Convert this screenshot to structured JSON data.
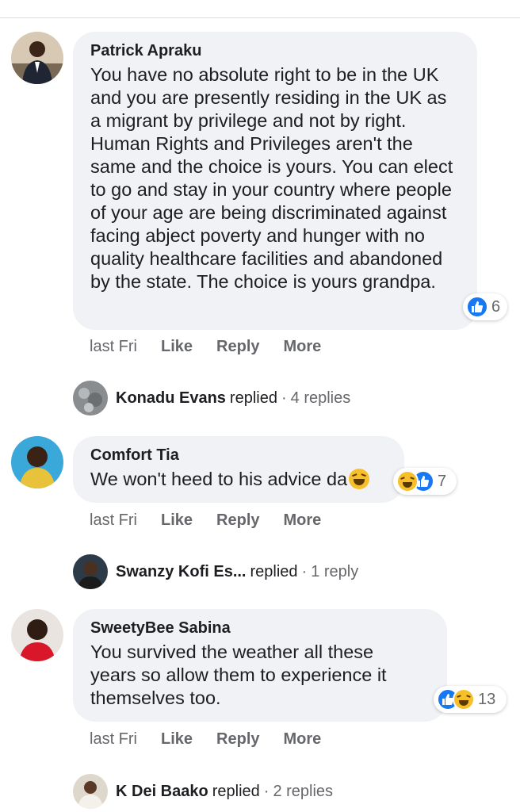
{
  "comments": [
    {
      "author": "Patrick Apraku",
      "text": "You have no absolute right to be in the UK and you are presently residing in the UK as a migrant by privilege and not by right. Human Rights and Privileges aren't the same and the choice is yours. You can elect to go and stay in your country where people of your age are being discriminated against facing abject poverty and hunger with no quality healthcare facilities and abandoned by the state. The choice is yours grandpa.",
      "reaction_count": "6",
      "time": "last Fri",
      "like": "Like",
      "reply": "Reply",
      "more": "More",
      "reply_summary": {
        "name": "Konadu Evans",
        "verb": "replied",
        "dot": "·",
        "count": "4 replies"
      }
    },
    {
      "author": "Comfort Tia",
      "text": "We won't heed to his advice da",
      "reaction_count": "7",
      "time": "last Fri",
      "like": "Like",
      "reply": "Reply",
      "more": "More",
      "reply_summary": {
        "name": "Swanzy Kofi Es...",
        "verb": "replied",
        "dot": "·",
        "count": "1 reply"
      }
    },
    {
      "author": "SweetyBee Sabina",
      "text": "You survived the weather all these years so allow them to experience it themselves too.",
      "reaction_count": "13",
      "time": "last Fri",
      "like": "Like",
      "reply": "Reply",
      "more": "More",
      "reply_summary": {
        "name": "K Dei Baako",
        "verb": "replied",
        "dot": "·",
        "count": "2 replies"
      }
    }
  ],
  "colors": {
    "like_blue": "#1877f2",
    "haha_yellow": "#f7c02a",
    "bubble_bg": "#f0f2f5",
    "meta_gray": "#65676b"
  }
}
